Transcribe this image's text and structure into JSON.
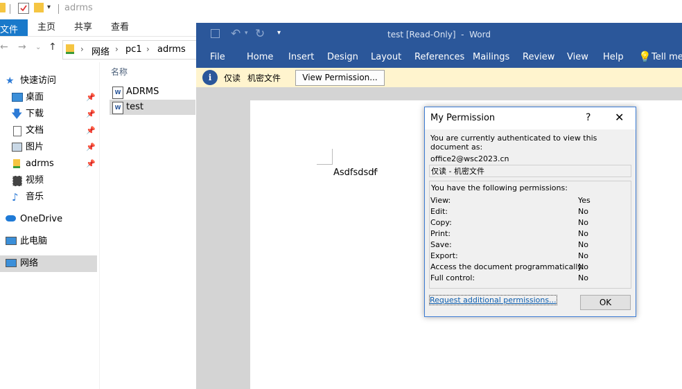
{
  "explorer": {
    "window_title": "adrms",
    "ribbon_tabs": [
      "文件",
      "主页",
      "共享",
      "查看"
    ],
    "address_path": [
      "网络",
      "pc1",
      "adrms"
    ],
    "column_header": "名称",
    "nav": {
      "quick_access": "快速访问",
      "items": [
        {
          "label": "桌面",
          "pinned": true
        },
        {
          "label": "下载",
          "pinned": true
        },
        {
          "label": "文档",
          "pinned": true
        },
        {
          "label": "图片",
          "pinned": true
        },
        {
          "label": "adrms",
          "pinned": true
        },
        {
          "label": "视频",
          "pinned": false
        },
        {
          "label": "音乐",
          "pinned": false
        }
      ],
      "onedrive": "OneDrive",
      "this_pc": "此电脑",
      "network": "网络"
    },
    "files": [
      {
        "name": "ADRMS",
        "selected": false
      },
      {
        "name": "test",
        "selected": true
      }
    ]
  },
  "word": {
    "title": "test [Read-Only]  -  Word",
    "menu": [
      "File",
      "Home",
      "Insert",
      "Design",
      "Layout",
      "References",
      "Mailings",
      "Review",
      "View",
      "Help",
      "Tell me w"
    ],
    "info_bar": {
      "label": "仅读",
      "classification": "机密文件",
      "button": "View Permission..."
    },
    "document_text": "Asdfsdsdf",
    "accent": "#2b579a"
  },
  "dialog": {
    "title": "My Permission",
    "help": "?",
    "auth_text": "You are currently authenticated to view this document as:",
    "user": "office2@wsc2023.cn",
    "policy": "仅读 - 机密文件",
    "perm_header": "You have the following permissions:",
    "permissions": [
      {
        "name": "View:",
        "value": "Yes"
      },
      {
        "name": "Edit:",
        "value": "No"
      },
      {
        "name": "Copy:",
        "value": "No"
      },
      {
        "name": "Print:",
        "value": "No"
      },
      {
        "name": "Save:",
        "value": "No"
      },
      {
        "name": "Export:",
        "value": "No"
      },
      {
        "name": "Access the document programmatically:",
        "value": "No"
      },
      {
        "name": "Full control:",
        "value": "No"
      }
    ],
    "request_link": "Request additional permissions...",
    "ok": "OK"
  }
}
